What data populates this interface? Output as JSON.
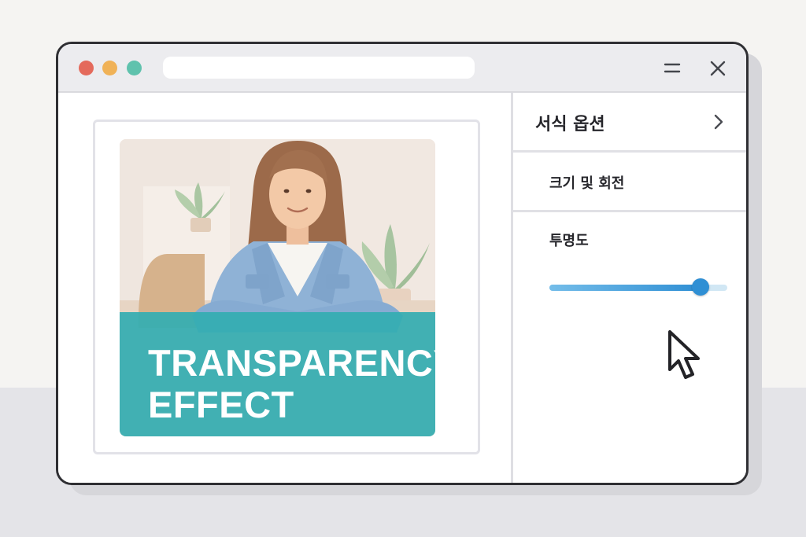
{
  "window": {
    "address_bar": "",
    "traffic_lights": [
      "#e46a5c",
      "#f0b257",
      "#5fc2ad"
    ],
    "controls": [
      "minimize-icon",
      "close-icon"
    ]
  },
  "canvas": {
    "image": "woman-in-denim-jacket-photo",
    "overlay_color": "#34adb2",
    "overlay_text": [
      "TRANSPARENCY",
      "EFFECT"
    ]
  },
  "panel": {
    "title": "서식 옵션",
    "sections": [
      {
        "label": "크기 및 회전"
      }
    ],
    "opacity": {
      "label": "투명도",
      "value_fraction": 0.85,
      "accent": "#2f8fd4"
    }
  }
}
